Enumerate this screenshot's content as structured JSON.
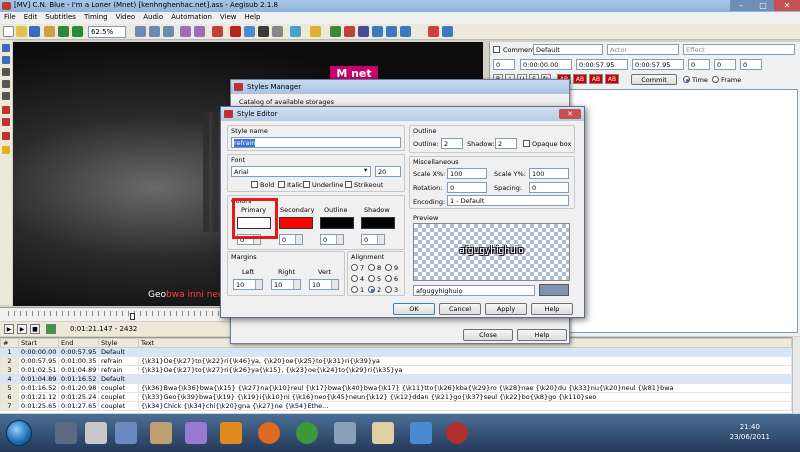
{
  "window": {
    "title": "[MV] C.N. Blue - I'm a Loner (Mnet) [kenhnghenhac.net].ass - Aegisub 2.1.8"
  },
  "menu": [
    "File",
    "Edit",
    "Subtitles",
    "Timing",
    "Video",
    "Audio",
    "Automation",
    "View",
    "Help"
  ],
  "toolbar": {
    "zoom": "62.5%"
  },
  "video": {
    "watermark": "M net",
    "subtitle_white": "Geo",
    "subtitle_red": "bwa inni neo"
  },
  "playback": {
    "timecode": "0:01:21.147 - 2432"
  },
  "editbox": {
    "comment_label": "Comment",
    "style": "Default",
    "actor_placeholder": "Actor",
    "effect_placeholder": "Effect",
    "layer": "0",
    "start": "0:00:00.00",
    "end": "0:00:57.95",
    "duration": "0:00:57.95",
    "margin_l": "0",
    "margin_r": "0",
    "margin_v": "0",
    "format_buttons": [
      "B",
      "I",
      "U",
      "S",
      "fn",
      "AB",
      "AB",
      "AB",
      "AB"
    ],
    "commit_label": "Commit",
    "time_label": "Time",
    "frame_label": "Frame"
  },
  "styles_manager": {
    "title": "Styles Manager",
    "catalog_label": "Catalog of available storages",
    "close_label": "Close",
    "help_label": "Help"
  },
  "style_editor": {
    "title": "Style Editor",
    "close_x": "✕",
    "style_name_label": "Style name",
    "style_name": "refrain",
    "font_label": "Font",
    "font_name": "Arial",
    "font_size": "20",
    "bold": "Bold",
    "italic": "Italic",
    "underline": "Underline",
    "strikeout": "Strikeout",
    "colors_label": "Colors",
    "primary": "Primary",
    "secondary": "Secondary",
    "outline": "Outline",
    "shadow": "Shadow",
    "alpha": [
      "0",
      "0",
      "0",
      "0"
    ],
    "colors": {
      "primary": "#ffffff",
      "secondary": "#ff0000",
      "outline": "#000000",
      "shadow": "#000000"
    },
    "margins_label": "Margins",
    "left_label": "Left",
    "right_label": "Right",
    "vert_label": "Vert",
    "margin_values": [
      "10",
      "10",
      "10"
    ],
    "alignment_label": "Alignment",
    "alignment_rows": [
      [
        "7",
        "8",
        "9"
      ],
      [
        "4",
        "5",
        "6"
      ],
      [
        "1",
        "2",
        "3"
      ]
    ],
    "outline_group_label": "Outline",
    "outline_label": "Outline:",
    "outline_value": "2",
    "shadow_label": "Shadow:",
    "shadow_value": "2",
    "opaque_box": "Opaque box",
    "misc_label": "Miscellaneous",
    "scalex_label": "Scale X%:",
    "scalex": "100",
    "scaley_label": "Scale Y%:",
    "scaley": "100",
    "rotation_label": "Rotation:",
    "rotation": "0",
    "spacing_label": "Spacing:",
    "spacing": "0",
    "encoding_label": "Encoding:",
    "encoding": "1 - Default",
    "preview_label": "Preview",
    "preview_text": "afgugyhighuio",
    "preview_input": "afgugyhighuio",
    "ok": "OK",
    "cancel": "Cancel",
    "apply": "Apply",
    "help": "Help"
  },
  "grid": {
    "headers": [
      "#",
      "Start",
      "End",
      "Style",
      "Text"
    ],
    "rows": [
      [
        "1",
        "0:00:00.00",
        "0:00:57.95",
        "Default",
        ""
      ],
      [
        "2",
        "0:00:57.95",
        "0:01:00.35",
        "refrain",
        "{\\k31}Oe{\\k27}to{\\k22}ri{\\k46}ya, {\\k20}oe{\\k25}to{\\k31}ri{\\k39}ya"
      ],
      [
        "3",
        "0:01:02.51",
        "0:01:04.89",
        "refrain",
        "{\\k31}Oe{\\k27}to{\\k27}ri{\\k26}ya{\\k15}, {\\k23}oe{\\k24}to{\\k29}ri{\\k35}ya"
      ],
      [
        "4",
        "0:01:04.89",
        "0:01:16.52",
        "Default",
        ""
      ],
      [
        "5",
        "0:01:16.52",
        "0:01:20.98",
        "couplet",
        "{\\k36}Bwa{\\k36}bwa{\\k15} {\\k27}na{\\k10}reul {\\k17}bwa{\\k40}bwa{\\k17} {\\k11}tto{\\k26}kba{\\k29}ro {\\k28}nae {\\k20}du {\\k33}nu{\\k20}neul {\\k81}bwa"
      ],
      [
        "6",
        "0:01:21.12",
        "0:01:25.24",
        "couplet",
        "{\\k33}Geo{\\k39}bwa{\\k19} {\\k19}i{\\k10}ni {\\k16}neo{\\k45}neun{\\k12} {\\k12}ddan {\\k21}go{\\k37}seul {\\k22}bo{\\k8}go {\\k110}seo"
      ],
      [
        "7",
        "0:01:25.65",
        "0:01:27.65",
        "couplet",
        "{\\k34}Chick {\\k34}chi{\\k20}gna {\\k27}ne {\\k54}Ethe..."
      ]
    ]
  },
  "taskbar": {
    "time": "21:40",
    "date": "23/06/2011"
  }
}
